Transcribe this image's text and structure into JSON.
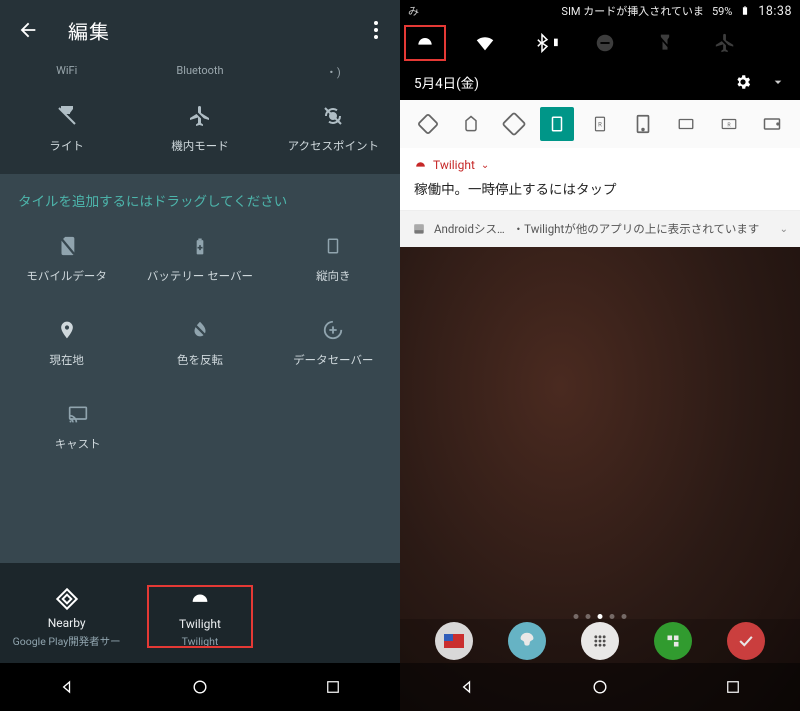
{
  "left": {
    "header_title": "編集",
    "partial_row": {
      "wifi": "WiFi",
      "bluetooth": "Bluetooth",
      "cast_hint": "・)"
    },
    "row1": [
      {
        "name": "light",
        "label": "ライト"
      },
      {
        "name": "airplane",
        "label": "機内モード"
      },
      {
        "name": "hotspot",
        "label": "アクセスポイント"
      }
    ],
    "drag_hint": "タイルを追加するにはドラッグしてください",
    "row2": [
      {
        "name": "mobile-data",
        "label": "モバイルデータ"
      },
      {
        "name": "battery-saver",
        "label": "バッテリー セーバー"
      },
      {
        "name": "portrait",
        "label": "縦向き"
      }
    ],
    "row3": [
      {
        "name": "location",
        "label": "現在地"
      },
      {
        "name": "invert-colors",
        "label": "色を反転"
      },
      {
        "name": "data-saver",
        "label": "データセーバー"
      }
    ],
    "row4": [
      {
        "name": "cast",
        "label": "キャスト"
      }
    ],
    "suggestions": [
      {
        "name": "nearby",
        "l1": "Nearby",
        "l2": "Google Play開発者サー"
      },
      {
        "name": "twilight",
        "l1": "Twilight",
        "l2": "Twilight",
        "highlight": true
      }
    ]
  },
  "right": {
    "status": {
      "ime_hint": "み",
      "sim_text": "SIM カードが挿入されていま",
      "battery_pct": "59%",
      "time": "18:38"
    },
    "date": "5月4日(金)",
    "twilight_notif": {
      "app": "Twilight",
      "body": "稼働中。一時停止するにはタップ"
    },
    "sys_notif": {
      "app": "Androidシス…",
      "text": "・Twilightが他のアプリの上に表示されています"
    },
    "page_dot_count": 5,
    "page_dot_active": 2,
    "dock": [
      "app1",
      "app2",
      "apps",
      "feedly",
      "wunder"
    ]
  }
}
